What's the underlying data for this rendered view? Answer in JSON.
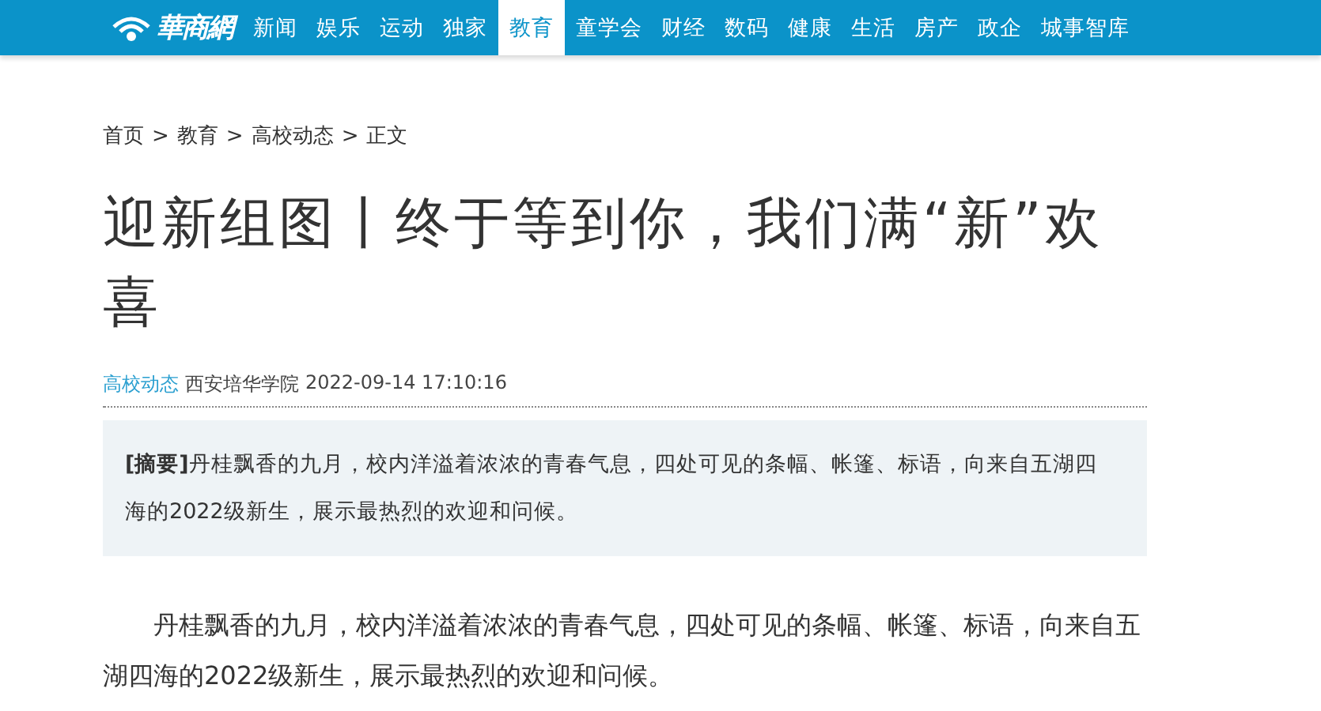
{
  "header": {
    "logo_text": "華商網",
    "nav": [
      {
        "label": "新闻",
        "selected": false
      },
      {
        "label": "娱乐",
        "selected": false
      },
      {
        "label": "运动",
        "selected": false
      },
      {
        "label": "独家",
        "selected": false
      },
      {
        "label": "教育",
        "selected": true
      },
      {
        "label": "童学会",
        "selected": false
      },
      {
        "label": "财经",
        "selected": false
      },
      {
        "label": "数码",
        "selected": false
      },
      {
        "label": "健康",
        "selected": false
      },
      {
        "label": "生活",
        "selected": false
      },
      {
        "label": "房产",
        "selected": false
      },
      {
        "label": "政企",
        "selected": false
      },
      {
        "label": "城事智库",
        "selected": false
      }
    ]
  },
  "breadcrumb": [
    "首页",
    "教育",
    "高校动态",
    "正文"
  ],
  "breadcrumb_separator": ">",
  "article": {
    "title": "迎新组图丨终于等到你，我们满“新”欢喜",
    "meta": {
      "category": "高校动态",
      "source": "西安培华学院",
      "time": "2022-09-14 17:10:16"
    },
    "summary": "**[摘要]**丹桂飘香的九月，校内洋溢着浓浓的青春气息，四处可见的条幅、帐篷、标语，向来自五湖四海的2022级新生，展示最热烈的欢迎和问候。",
    "paragraphs": [
      "丹桂飘香的九月，校内洋溢着浓浓的青春气息，四处可见的条幅、帐篷、标语，向来自五湖四海的2022级新生，展示最热烈的欢迎和问候。"
    ]
  }
}
